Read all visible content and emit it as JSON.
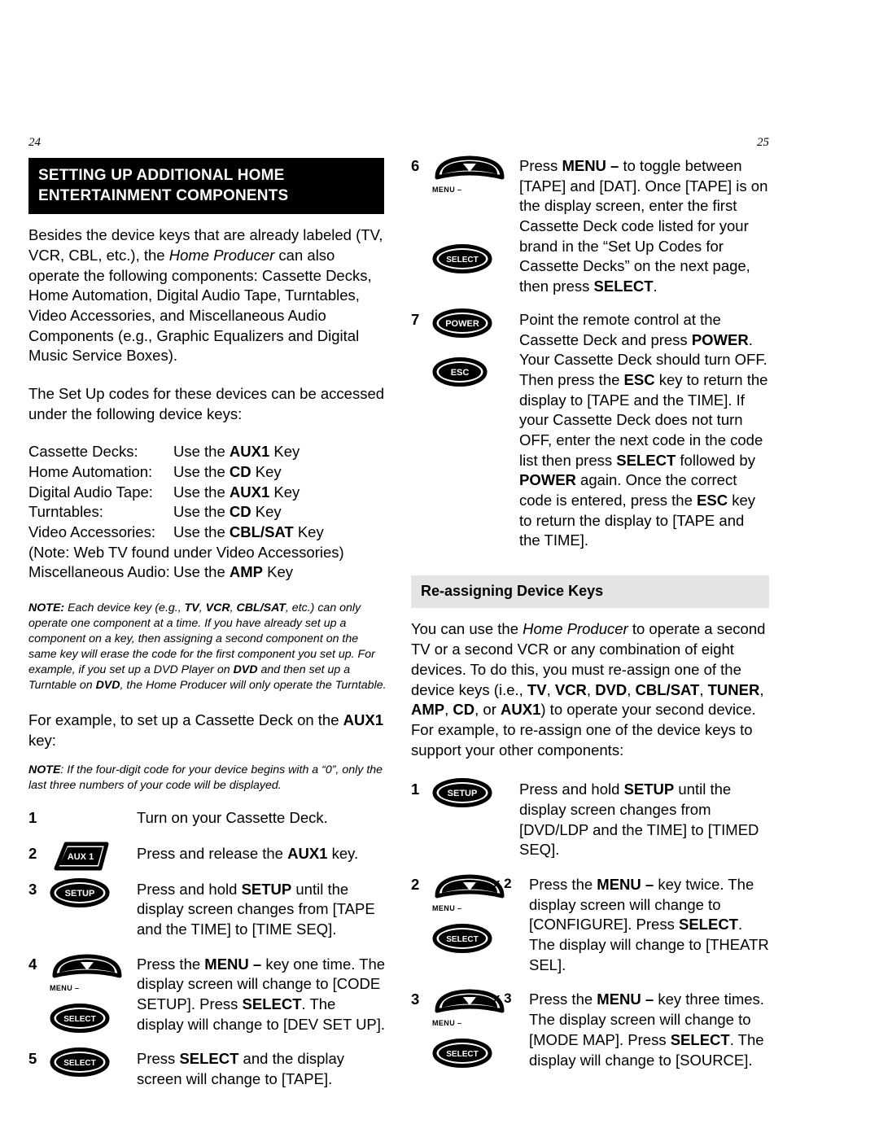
{
  "document": {
    "left_page_number": "24",
    "right_page_number": "25"
  },
  "left_column": {
    "section_header_line1": "SETTING UP ADDITIONAL HOME",
    "section_header_line2": "ENTERTAINMENT COMPONENTS",
    "intro_paragraph": "Besides the device keys that are already labeled (TV, VCR, CBL, etc.), the Home Producer can also operate the following components: Cassette Decks, Home Automation, Digital Audio Tape, Turntables, Video Accessories, and Miscellaneous Audio Components (e.g., Graphic Equalizers and Digital Music Service Boxes).",
    "intro_italic_phrase": "Home Producer",
    "codes_paragraph": "The Set Up codes for these devices can be accessed under the following device keys:",
    "key_list": [
      {
        "device": "Cassette Decks:",
        "use_prefix": "Use the ",
        "key": "AUX1",
        "use_suffix": " Key"
      },
      {
        "device": "Home Automation:",
        "use_prefix": "Use the ",
        "key": "CD",
        "use_suffix": " Key"
      },
      {
        "device": "Digital Audio Tape:",
        "use_prefix": "Use the ",
        "key": "AUX1",
        "use_suffix": " Key"
      },
      {
        "device": "Turntables:",
        "use_prefix": "Use the ",
        "key": "CD",
        "use_suffix": " Key"
      },
      {
        "device": "Video Accessories:",
        "use_prefix": "Use the ",
        "key": "CBL/SAT",
        "use_suffix": " Key"
      }
    ],
    "key_list_note_line": "(Note: Web TV found under Video Accessories)",
    "key_list_last": {
      "device": "Miscellaneous Audio:",
      "use_prefix": "Use the ",
      "key": "AMP",
      "use_suffix": " Key"
    },
    "note_1_label": "NOTE:",
    "note_1_text": " Each device key (e.g., TV, VCR, CBL/SAT, etc.) can only operate one component at a time. If you have already set up a component on a key, then assigning a second component on the same key will erase the code for the first component you set up. For example, if you set up a DVD Player on DVD and then set up a Turntable on DVD, the Home Producer will only operate the Turntable.",
    "example_paragraph_1": "For example, to set up a Cassette Deck on the ",
    "example_paragraph_key": "AUX1",
    "example_paragraph_2": " key:",
    "note_2_label": "NOTE",
    "note_2_text": ": If the four-digit code for your device begins with a “0”, only the last three numbers of your code will be displayed.",
    "steps": [
      {
        "number": "1",
        "icons": [],
        "text_parts": [
          {
            "text": "Turn on your Cassette Deck.",
            "bold": false
          }
        ]
      },
      {
        "number": "2",
        "icons": [
          "aux1-key"
        ],
        "text_parts": [
          {
            "text": "Press and release the ",
            "bold": false
          },
          {
            "text": "AUX1",
            "bold": true
          },
          {
            "text": " key.",
            "bold": false
          }
        ]
      },
      {
        "number": "3",
        "icons": [
          "setup-key"
        ],
        "text_parts": [
          {
            "text": "Press and hold ",
            "bold": false
          },
          {
            "text": "SETUP",
            "bold": true
          },
          {
            "text": " until the display screen changes from [TAPE and the TIME] to [TIME SEQ].",
            "bold": false
          }
        ]
      },
      {
        "number": "4",
        "icons": [
          "menu-minus-key",
          "select-key"
        ],
        "text_parts": [
          {
            "text": "Press the ",
            "bold": false
          },
          {
            "text": "MENU –",
            "bold": true
          },
          {
            "text": " key one time. The display screen will change to [CODE SETUP]. Press ",
            "bold": false
          },
          {
            "text": "SELECT",
            "bold": true
          },
          {
            "text": ". The display will change to [DEV SET UP].",
            "bold": false
          }
        ]
      },
      {
        "number": "5",
        "icons": [
          "select-key"
        ],
        "text_parts": [
          {
            "text": "Press ",
            "bold": false
          },
          {
            "text": "SELECT",
            "bold": true
          },
          {
            "text": " and the display screen will change to [TAPE].",
            "bold": false
          }
        ]
      }
    ]
  },
  "right_column": {
    "steps_continued": [
      {
        "number": "6",
        "icons": [
          "menu-minus-key",
          "select-key"
        ],
        "text_parts": [
          {
            "text": "Press ",
            "bold": false
          },
          {
            "text": "MENU –",
            "bold": true
          },
          {
            "text": " to toggle between [TAPE] and [DAT]. Once [TAPE] is on the display screen, enter the first Cassette Deck code listed for your brand in the “Set Up Codes for Cassette Decks” on the next page, then press ",
            "bold": false
          },
          {
            "text": "SELECT",
            "bold": true
          },
          {
            "text": ".",
            "bold": false
          }
        ]
      },
      {
        "number": "7",
        "icons": [
          "power-key",
          "esc-key"
        ],
        "text_parts": [
          {
            "text": "Point the remote control at the Cassette Deck and press ",
            "bold": false
          },
          {
            "text": "POWER",
            "bold": true
          },
          {
            "text": ". Your Cassette Deck should turn OFF. Then press the ",
            "bold": false
          },
          {
            "text": "ESC",
            "bold": true
          },
          {
            "text": " key to return the display to [TAPE and the TIME]. If your Cassette Deck does not turn OFF, enter the next code in the code list then press ",
            "bold": false
          },
          {
            "text": "SELECT",
            "bold": true
          },
          {
            "text": " followed by ",
            "bold": false
          },
          {
            "text": "POWER",
            "bold": true
          },
          {
            "text": " again. Once the correct code is entered, press the ",
            "bold": false
          },
          {
            "text": "ESC",
            "bold": true
          },
          {
            "text": " key to return the display to [TAPE and the TIME].",
            "bold": false
          }
        ]
      }
    ],
    "subsection_header": "Re-assigning Device Keys",
    "reassign_paragraph_parts": [
      {
        "text": "You can use the ",
        "bold": false,
        "italic": false
      },
      {
        "text": "Home Producer",
        "bold": false,
        "italic": true
      },
      {
        "text": " to operate a second TV or a second VCR or any combination of eight devices. To do this, you must re-assign one of the device keys (i.e., ",
        "bold": false,
        "italic": false
      },
      {
        "text": "TV",
        "bold": true,
        "italic": false
      },
      {
        "text": ", ",
        "bold": false,
        "italic": false
      },
      {
        "text": "VCR",
        "bold": true,
        "italic": false
      },
      {
        "text": ", ",
        "bold": false,
        "italic": false
      },
      {
        "text": "DVD",
        "bold": true,
        "italic": false
      },
      {
        "text": ", ",
        "bold": false,
        "italic": false
      },
      {
        "text": "CBL/SAT",
        "bold": true,
        "italic": false
      },
      {
        "text": ", ",
        "bold": false,
        "italic": false
      },
      {
        "text": "TUNER",
        "bold": true,
        "italic": false
      },
      {
        "text": ", ",
        "bold": false,
        "italic": false
      },
      {
        "text": "AMP",
        "bold": true,
        "italic": false
      },
      {
        "text": ", ",
        "bold": false,
        "italic": false
      },
      {
        "text": "CD",
        "bold": true,
        "italic": false
      },
      {
        "text": ", or ",
        "bold": false,
        "italic": false
      },
      {
        "text": "AUX1",
        "bold": true,
        "italic": false
      },
      {
        "text": ") to operate your second device. For example, to re-assign one of the device keys to support your other components:",
        "bold": false,
        "italic": false
      }
    ],
    "steps": [
      {
        "number": "1",
        "icons": [
          "setup-key"
        ],
        "multiplier": "",
        "text_parts": [
          {
            "text": "Press and hold ",
            "bold": false
          },
          {
            "text": "SETUP",
            "bold": true
          },
          {
            "text": " until the display screen changes from [DVD/LDP and the TIME] to [TIMED SEQ].",
            "bold": false
          }
        ]
      },
      {
        "number": "2",
        "icons": [
          "menu-minus-key",
          "select-key"
        ],
        "multiplier": "x 2",
        "text_parts": [
          {
            "text": "Press the ",
            "bold": false
          },
          {
            "text": "MENU –",
            "bold": true
          },
          {
            "text": " key twice. The display screen will change to [CONFIGURE]. Press ",
            "bold": false
          },
          {
            "text": "SELECT",
            "bold": true
          },
          {
            "text": ". The display will change to [THEATR SEL].",
            "bold": false
          }
        ]
      },
      {
        "number": "3",
        "icons": [
          "menu-minus-key",
          "select-key"
        ],
        "multiplier": "x 3",
        "text_parts": [
          {
            "text": "Press the ",
            "bold": false
          },
          {
            "text": "MENU –",
            "bold": true
          },
          {
            "text": " key three times. The display screen will change to [MODE MAP]. Press ",
            "bold": false
          },
          {
            "text": "SELECT",
            "bold": true
          },
          {
            "text": ". The display will change to [SOURCE].",
            "bold": false
          }
        ]
      }
    ]
  },
  "icon_labels": {
    "aux1-key": "AUX 1",
    "setup-key": "SETUP",
    "select-key": "SELECT",
    "power-key": "POWER",
    "esc-key": "ESC",
    "menu-minus-key": "MENU –"
  },
  "colors": {
    "header_bar_bg": "#000000",
    "header_bar_text": "#ffffff",
    "subheader_bar_bg": "#e4e4e4",
    "page_bg": "#ffffff",
    "text": "#000000"
  }
}
